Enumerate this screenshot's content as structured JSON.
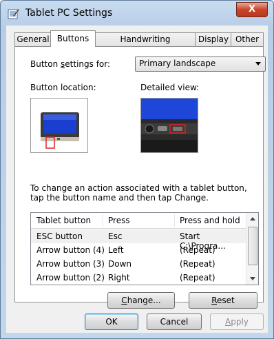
{
  "window": {
    "title": "Tablet PC Settings",
    "close_label": "X"
  },
  "tabs": [
    {
      "label": "General"
    },
    {
      "label": "Buttons"
    },
    {
      "label": "Handwriting Recognition"
    },
    {
      "label": "Display"
    },
    {
      "label": "Other"
    }
  ],
  "active_tab": "Buttons",
  "buttons_tab": {
    "settings_for_label_pre": "Button ",
    "settings_for_label_accel": "s",
    "settings_for_label_post": "ettings for:",
    "settings_for_value": "Primary landscape",
    "location_label": "Button location:",
    "detailed_label": "Detailed view:",
    "hint": "To change an action associated with a tablet button, tap the button name and then tap Change.",
    "table": {
      "columns": [
        "Tablet button",
        "Press",
        "Press and hold"
      ],
      "rows": [
        {
          "button": "ESC button",
          "press": "Esc",
          "hold": "Start C:\\Progra..."
        },
        {
          "button": "Arrow button (4)",
          "press": "Left",
          "hold": "(Repeat)"
        },
        {
          "button": "Arrow button (3)",
          "press": "Down",
          "hold": "(Repeat)"
        },
        {
          "button": "Arrow button (2)",
          "press": "Right",
          "hold": "(Repeat)"
        }
      ]
    },
    "change_accel": "C",
    "change_rest": "hange...",
    "reset_accel": "R",
    "reset_rest": "eset"
  },
  "footer": {
    "ok": "OK",
    "cancel": "Cancel",
    "apply_accel": "A",
    "apply_rest": "pply"
  },
  "colors": {
    "accent_blue": "#1e46d8",
    "highlight_red": "#e02020"
  }
}
